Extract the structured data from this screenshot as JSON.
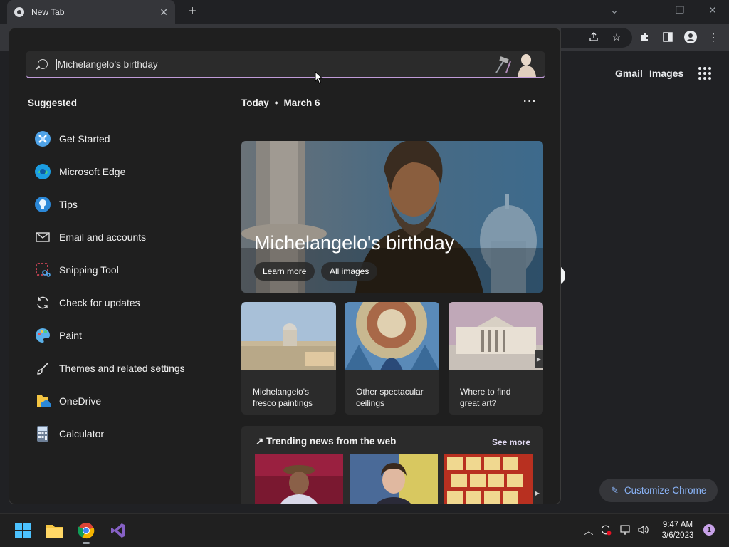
{
  "browser": {
    "tab_title": "New Tab",
    "tab_close": "✕",
    "new_tab": "+",
    "window_controls": {
      "dropdown": "⌄",
      "minimize": "—",
      "restore": "❐",
      "close": "✕"
    }
  },
  "ntp": {
    "gmail": "Gmail",
    "images": "Images",
    "customize": "Customize Chrome"
  },
  "search": {
    "query": "Michelangelo's birthday"
  },
  "suggested": {
    "title": "Suggested",
    "items": [
      {
        "label": "Get Started",
        "icon": "get-started-icon"
      },
      {
        "label": "Microsoft Edge",
        "icon": "edge-icon"
      },
      {
        "label": "Tips",
        "icon": "tips-icon"
      },
      {
        "label": "Email and accounts",
        "icon": "mail-icon"
      },
      {
        "label": "Snipping Tool",
        "icon": "snipping-tool-icon"
      },
      {
        "label": "Check for updates",
        "icon": "refresh-icon"
      },
      {
        "label": "Paint",
        "icon": "paint-icon"
      },
      {
        "label": "Themes and related settings",
        "icon": "brush-icon"
      },
      {
        "label": "OneDrive",
        "icon": "onedrive-icon"
      },
      {
        "label": "Calculator",
        "icon": "calculator-icon"
      }
    ]
  },
  "today": {
    "label": "Today",
    "separator": "•",
    "date": "March 6",
    "more": "···"
  },
  "hero": {
    "title": "Michelangelo's birthday",
    "learn_more": "Learn more",
    "all_images": "All images"
  },
  "cards": [
    {
      "caption": "Michelangelo's fresco paintings"
    },
    {
      "caption": "Other spectacular ceilings"
    },
    {
      "caption": "Where to find great art?"
    }
  ],
  "trending": {
    "title": "Trending news from the web",
    "see_more": "See more"
  },
  "taskbar": {
    "time": "9:47 AM",
    "date": "3/6/2023",
    "notifications": "1"
  }
}
